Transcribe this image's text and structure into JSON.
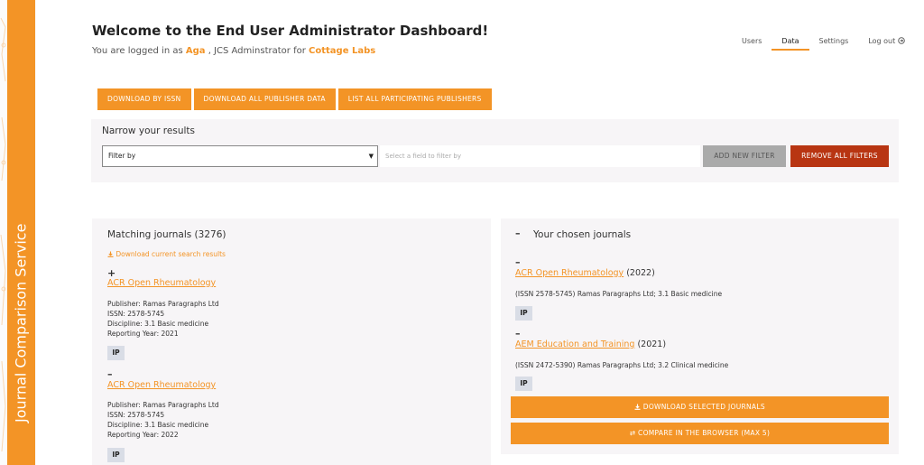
{
  "sidebar": {
    "title": "Journal Comparison Service"
  },
  "header": {
    "title": "Welcome to the End User Administrator Dashboard!",
    "logged_prefix": "You are logged in as",
    "user": "Aga",
    "role_text": ", JCS Adminstrator for",
    "org": "Cottage Labs"
  },
  "nav": {
    "users": "Users",
    "data": "Data",
    "settings": "Settings",
    "logout": "Log out"
  },
  "actions": {
    "download_issn": "DOWNLOAD BY ISSN",
    "download_all": "DOWNLOAD ALL PUBLISHER DATA",
    "list_publishers": "LIST ALL PARTICIPATING PUBLISHERS"
  },
  "filters": {
    "heading": "Narrow your results",
    "select_value": "Filter by",
    "input_placeholder": "Select a field to filter by",
    "add": "ADD NEW FILTER",
    "remove": "REMOVE ALL FILTERS"
  },
  "matching": {
    "title": "Matching journals (3276)",
    "download_link": "Download current search results",
    "items": [
      {
        "sign": "+",
        "title": "ACR Open Rheumatology",
        "publisher": "Publisher: Ramas Paragraphs Ltd",
        "issn": "ISSN: 2578-5745",
        "discipline": "Discipline: 3.1 Basic medicine",
        "year": "Reporting Year: 2021",
        "badge": "IP"
      },
      {
        "sign": "–",
        "title": "ACR Open Rheumatology",
        "publisher": "Publisher: Ramas Paragraphs Ltd",
        "issn": "ISSN: 2578-5745",
        "discipline": "Discipline: 3.1 Basic medicine",
        "year": "Reporting Year: 2022",
        "badge": "IP"
      }
    ]
  },
  "chosen": {
    "collapse_sign": "–",
    "title": "Your chosen journals",
    "items": [
      {
        "sign": "–",
        "title": "ACR Open Rheumatology",
        "year": "(2022)",
        "detail": "(ISSN 2578-5745) Ramas Paragraphs Ltd; 3.1 Basic medicine",
        "badge": "IP"
      },
      {
        "sign": "–",
        "title": "AEM Education and Training",
        "year": "(2021)",
        "detail": "(ISSN 2472-5390) Ramas Paragraphs Ltd; 3.2 Clinical medicine",
        "badge": "IP"
      }
    ],
    "download_btn": "DOWNLOAD SELECTED JOURNALS",
    "compare_btn": "COMPARE IN THE BROWSER (MAX 5)"
  },
  "colors": {
    "accent": "#f39426",
    "danger": "#b83512",
    "panel": "#f7f5f7"
  }
}
